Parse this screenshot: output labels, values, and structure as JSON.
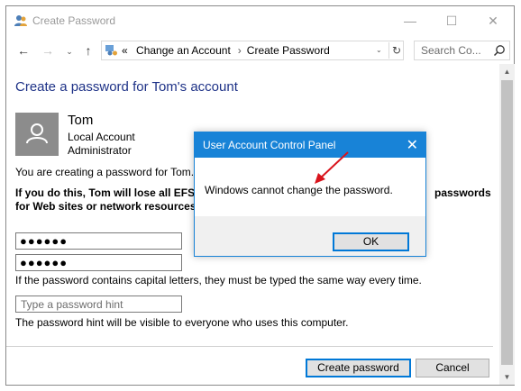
{
  "window": {
    "title": "Create Password",
    "min_glyph": "—",
    "max_glyph": "☐",
    "close_glyph": "✕"
  },
  "nav": {
    "back_glyph": "←",
    "forward_glyph": "→",
    "recent_glyph": "⌄",
    "up_glyph": "↑",
    "breadcrumb_prefix": "«",
    "breadcrumb": [
      "Change an Account",
      "Create Password"
    ],
    "breadcrumb_sep": "›",
    "dropdown_glyph": "⌄",
    "refresh_glyph": "↻",
    "search_placeholder": "Search Co..."
  },
  "main": {
    "heading": "Create a password for Tom's account",
    "user": {
      "name": "Tom",
      "account_type": "Local Account",
      "role": "Administrator"
    },
    "intro": "You are creating a password for Tom.",
    "warning_line1": "If you do this, Tom will lose all EFS-e",
    "warning_tail": "passwords",
    "warning_line2": "for Web sites or network resources.",
    "password_value": "●●●●●●",
    "confirm_value": "●●●●●●",
    "capital_note": "If the password contains capital letters, they must be typed the same way every time.",
    "hint_placeholder": "Type a password hint",
    "hint_note": "The password hint will be visible to everyone who uses this computer.",
    "create_button": "Create password",
    "cancel_button": "Cancel"
  },
  "dialog": {
    "title": "User Account Control Panel",
    "close_glyph": "✕",
    "message": "Windows cannot change the password.",
    "ok_button": "OK"
  },
  "colors": {
    "accent": "#1883d7",
    "heading": "#1e3287",
    "annotation_arrow": "#d9141c"
  },
  "icons": {
    "title": "users-icon",
    "address": "control-panel-icon",
    "search": "search-icon",
    "avatar": "user-avatar-icon"
  }
}
